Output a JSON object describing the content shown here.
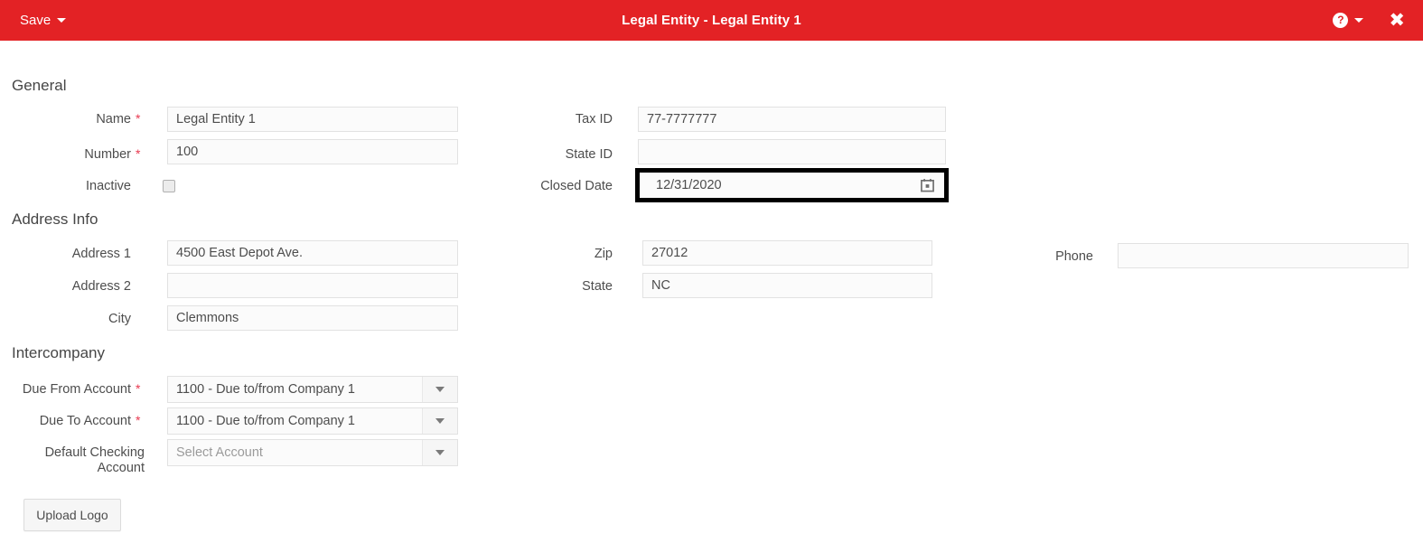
{
  "titlebar": {
    "save_label": "Save",
    "window_title": "Legal Entity - Legal Entity 1",
    "help_glyph": "?",
    "close_glyph": "✖",
    "accent_color": "#e32225"
  },
  "sections": {
    "general": {
      "title": "General"
    },
    "address": {
      "title": "Address Info"
    },
    "intercompany": {
      "title": "Intercompany"
    }
  },
  "fields": {
    "name": {
      "label": "Name",
      "value": "Legal Entity 1",
      "required": "*"
    },
    "number": {
      "label": "Number",
      "value": "100",
      "required": "*"
    },
    "inactive": {
      "label": "Inactive",
      "checked": false
    },
    "tax_id": {
      "label": "Tax ID",
      "value": "77-7777777"
    },
    "state_id": {
      "label": "State ID",
      "value": ""
    },
    "closed_date": {
      "label": "Closed Date",
      "value": "12/31/2020"
    },
    "address1": {
      "label": "Address 1",
      "value": "4500 East Depot Ave."
    },
    "address2": {
      "label": "Address 2",
      "value": ""
    },
    "city": {
      "label": "City",
      "value": "Clemmons"
    },
    "zip": {
      "label": "Zip",
      "value": "27012"
    },
    "state": {
      "label": "State",
      "value": "NC"
    },
    "phone": {
      "label": "Phone",
      "value": ""
    },
    "due_from_account": {
      "label": "Due From Account",
      "value": "1100 - Due to/from Company 1",
      "required": "*"
    },
    "due_to_account": {
      "label": "Due To Account",
      "value": "1100 - Due to/from Company 1",
      "required": "*"
    },
    "default_checking_account": {
      "label": "Default Checking Account",
      "value": "",
      "placeholder": "Select Account"
    }
  },
  "buttons": {
    "upload_logo": "Upload Logo"
  }
}
